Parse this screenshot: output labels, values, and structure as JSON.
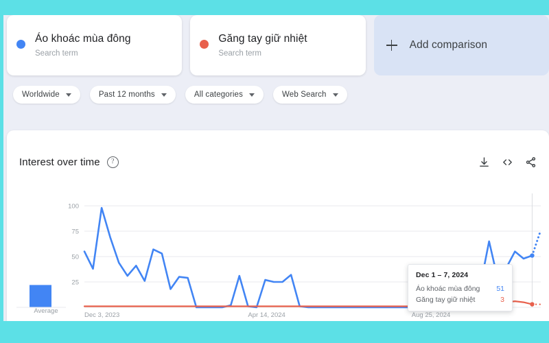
{
  "theme": {
    "frame_color": "#5ce0e6",
    "page_bg": "#eceef6",
    "card_bg": "#ffffff",
    "series_blue": "#4285f4",
    "series_red": "#e8604c",
    "add_card_bg": "#d9e3f5",
    "text_primary": "#202124",
    "text_secondary": "#9aa0a6"
  },
  "comparison": {
    "terms": [
      {
        "name": "Áo khoác mùa đông",
        "subtitle": "Search term",
        "color": "#4285f4"
      },
      {
        "name": "Găng tay giữ nhiệt",
        "subtitle": "Search term",
        "color": "#e8604c"
      }
    ],
    "add_comparison_label": "Add comparison"
  },
  "filters": [
    {
      "label": "Worldwide",
      "name": "location"
    },
    {
      "label": "Past 12 months",
      "name": "time-range"
    },
    {
      "label": "All categories",
      "name": "category"
    },
    {
      "label": "Web Search",
      "name": "search-type"
    }
  ],
  "chart_panel": {
    "title": "Interest over time",
    "help_glyph": "?",
    "actions": [
      {
        "name": "download-icon"
      },
      {
        "name": "embed-code-icon"
      },
      {
        "name": "share-icon"
      }
    ],
    "average_label": "Average"
  },
  "tooltip": {
    "date": "Dec 1 – 7, 2024",
    "rows": [
      {
        "name": "Áo khoác mùa đông",
        "value": "51",
        "color": "#4285f4"
      },
      {
        "name": "Găng tay giữ nhiệt",
        "value": "3",
        "color": "#e8604c"
      }
    ]
  },
  "chart_data": {
    "type": "line",
    "title": "Interest over time",
    "xlabel": "",
    "ylabel": "",
    "ylim": [
      0,
      100
    ],
    "grid": true,
    "legend_position": "top-cards",
    "x_tick_labels": [
      "Dec 3, 2023",
      "Apr 14, 2024",
      "Aug 25, 2024"
    ],
    "x_tick_positions": [
      0,
      19,
      38
    ],
    "y_tick_labels": [
      "25",
      "50",
      "75",
      "100"
    ],
    "y_tick_values": [
      25,
      50,
      75,
      100
    ],
    "average_bar": {
      "label": "Average",
      "value": 22,
      "color": "#4285f4"
    },
    "highlight": {
      "index": 52,
      "date": "Dec 1 – 7, 2024"
    },
    "partial_from_index": 52,
    "series": [
      {
        "name": "Áo khoác mùa đông",
        "color": "#4285f4",
        "values": [
          55,
          38,
          98,
          69,
          44,
          31,
          41,
          26,
          57,
          53,
          18,
          30,
          29,
          0,
          0,
          0,
          0,
          2,
          31,
          1,
          0,
          27,
          25,
          25,
          32,
          1,
          0,
          0,
          0,
          0,
          0,
          0,
          0,
          0,
          0,
          0,
          0,
          0,
          0,
          0,
          20,
          0,
          0,
          0,
          0,
          0,
          22,
          65,
          28,
          39,
          55,
          48,
          51,
          76
        ]
      },
      {
        "name": "Găng tay giữ nhiệt",
        "color": "#e8604c",
        "values": [
          1,
          1,
          1,
          1,
          1,
          1,
          1,
          1,
          1,
          1,
          1,
          1,
          1,
          1,
          1,
          1,
          1,
          1,
          1,
          1,
          1,
          1,
          1,
          1,
          1,
          1,
          1,
          1,
          1,
          1,
          1,
          1,
          1,
          1,
          1,
          1,
          1,
          1,
          1,
          1,
          1,
          1,
          1,
          1,
          1,
          1,
          1,
          2,
          3,
          5,
          6,
          5,
          3,
          3
        ]
      }
    ]
  }
}
